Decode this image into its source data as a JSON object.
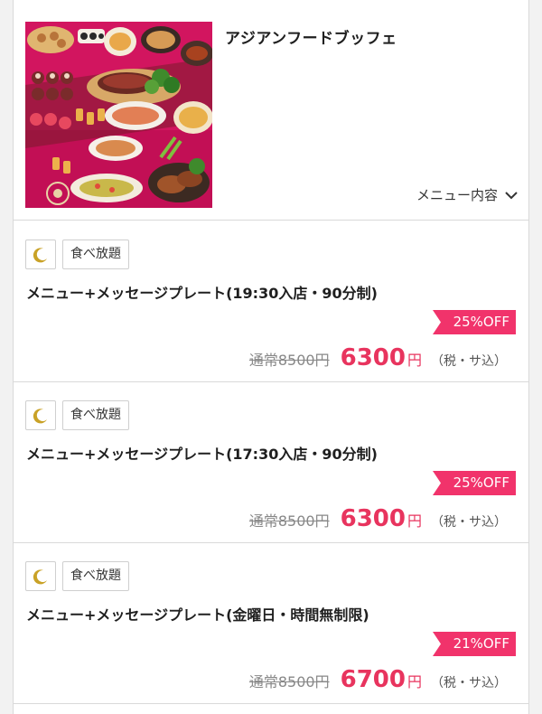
{
  "header": {
    "title": "アジアンフードブッフェ",
    "menu_toggle_label": "メニュー内容",
    "photo_icon": "buffet-food-photo"
  },
  "colors": {
    "accent": "#e8345e",
    "badge": "#f1336b",
    "moon": "#c9a227"
  },
  "plans": [
    {
      "icon": "moon-icon",
      "tag": "食べ放題",
      "name": "メニュー+メッセージプレート(19:30入店・90分制)",
      "discount": "25%OFF",
      "regular_price": "通常8500円",
      "price": "6300",
      "currency": "円",
      "tax_note": "（税・サ込）"
    },
    {
      "icon": "moon-icon",
      "tag": "食べ放題",
      "name": "メニュー+メッセージプレート(17:30入店・90分制)",
      "discount": "25%OFF",
      "regular_price": "通常8500円",
      "price": "6300",
      "currency": "円",
      "tax_note": "（税・サ込）"
    },
    {
      "icon": "moon-icon",
      "tag": "食べ放題",
      "name": "メニュー+メッセージプレート(金曜日・時間無制限)",
      "discount": "21%OFF",
      "regular_price": "通常8500円",
      "price": "6700",
      "currency": "円",
      "tax_note": "（税・サ込）"
    }
  ]
}
